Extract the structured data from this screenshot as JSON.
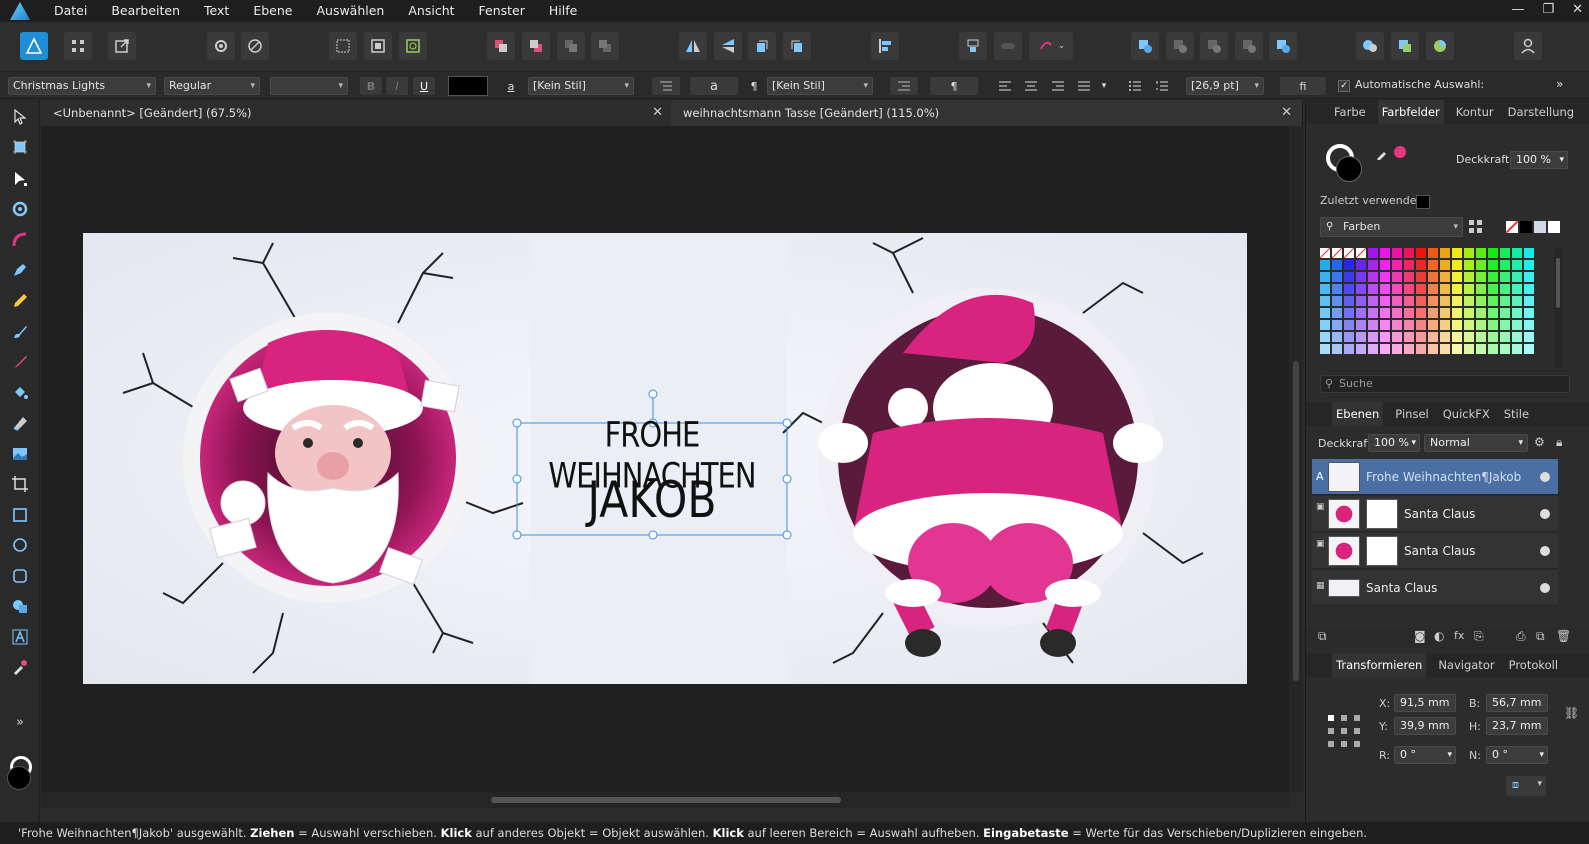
{
  "app": {
    "logo": "affinity-designer-logo"
  },
  "menu": [
    "Datei",
    "Bearbeiten",
    "Text",
    "Ebene",
    "Auswählen",
    "Ansicht",
    "Fenster",
    "Hilfe"
  ],
  "window_controls": [
    "—",
    "❐",
    "✕"
  ],
  "context_bar": {
    "font_family": "Christmas Lights",
    "font_style": "Regular",
    "font_size": "",
    "bold": "B",
    "italic": "I",
    "underline": "U",
    "char_style_glyph": "a",
    "char_style": "[Kein Stil]",
    "para_glyph": "a",
    "para_mark": "¶",
    "para_style": "[Kein Stil]",
    "para_mark2": "¶",
    "size_value": "[26,9 pt]",
    "ligature": "fi",
    "auto_select_label": "Automatische Auswahl:",
    "overflow": "»"
  },
  "tabs": [
    {
      "label": "<Unbenannt> [Geändert] (67.5%)",
      "close": "✕"
    },
    {
      "label": "weihnachtsmann Tasse [Geändert] (115.0%)",
      "close": "✕"
    }
  ],
  "document": {
    "text_line1": "FROHE WEIHNACHTEN",
    "text_line2": "JAKOB",
    "colors": {
      "pink": "#d8247e",
      "beard": "#ffffff",
      "wall": "#eef0f6"
    }
  },
  "color_panel": {
    "tabs": [
      "Farbe",
      "Farbfelder",
      "Kontur",
      "Darstellung"
    ],
    "active_tab": "Farbfelder",
    "opacity_label": "Deckkraft:",
    "opacity_value": "100 %",
    "recent_label": "Zuletzt verwendet:",
    "palette_name": "Farben",
    "search_placeholder": "Suche"
  },
  "layers_panel": {
    "tabs": [
      "Ebenen",
      "Pinsel",
      "QuickFX",
      "Stile"
    ],
    "opacity_label": "Deckkraft:",
    "opacity_value": "100 %",
    "blend_mode": "Normal",
    "layers": [
      {
        "name": "Frohe Weihnachten¶Jakob",
        "selected": true,
        "type_badge": "A"
      },
      {
        "name": "Santa Claus",
        "selected": false
      },
      {
        "name": "Santa Claus",
        "selected": false
      },
      {
        "name": "Santa Claus",
        "selected": false
      }
    ]
  },
  "transform_panel": {
    "tabs": [
      "Transformieren",
      "Navigator",
      "Protokoll"
    ],
    "x_label": "X:",
    "x_value": "91,5 mm",
    "y_label": "Y:",
    "y_value": "39,9 mm",
    "w_label": "B:",
    "w_value": "56,7 mm",
    "h_label": "H:",
    "h_value": "23,7 mm",
    "r_label": "R:",
    "r_value": "0 °",
    "s_label": "N:",
    "s_value": "0 °"
  },
  "status": {
    "p1": "'Frohe Weihnachten¶Jakob' ausgewählt. ",
    "b1": "Ziehen",
    "p2": " = Auswahl verschieben. ",
    "b2": "Klick",
    "p3": " auf anderes Objekt = Objekt auswählen. ",
    "b3": "Klick",
    "p4": " auf leeren Bereich = Auswahl aufheben. ",
    "b4": "Eingabetaste",
    "p5": " = Werte für das Verschieben/Duplizieren eingeben."
  }
}
